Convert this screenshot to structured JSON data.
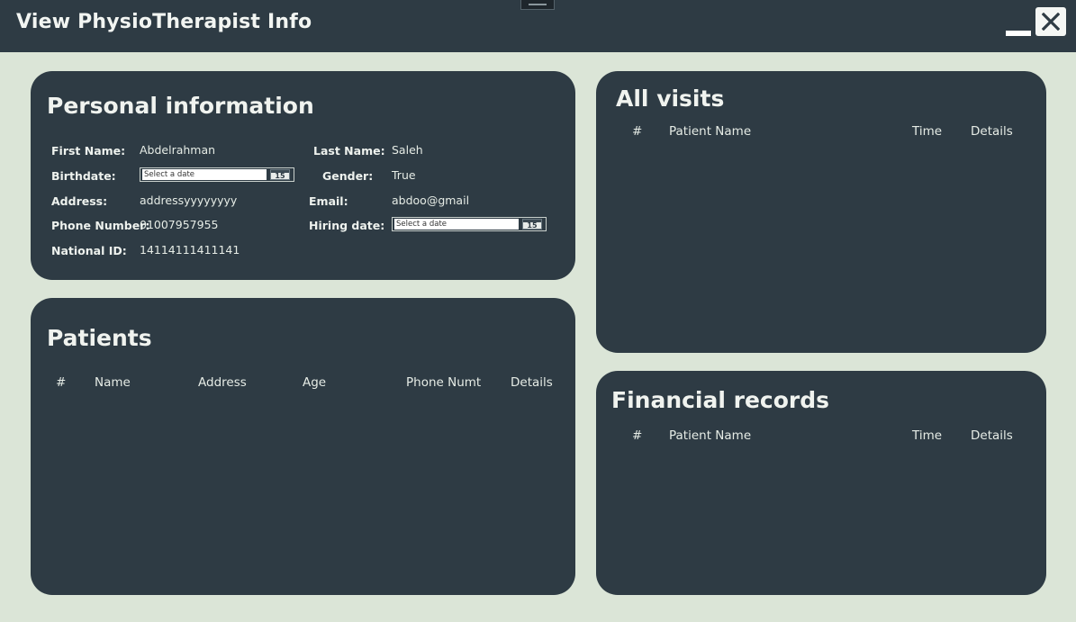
{
  "window": {
    "title": "View PhysioTherapist Info"
  },
  "personal": {
    "title": "Personal information",
    "first_name_label": "First Name:",
    "first_name": "Abdelrahman",
    "last_name_label": "Last Name:",
    "last_name": "Saleh",
    "birthdate_label": "Birthdate:",
    "birthdate_placeholder": "Select a date",
    "gender_label": "Gender:",
    "gender": "True",
    "address_label": "Address:",
    "address": "addressyyyyyyyy",
    "email_label": "Email:",
    "email": "abdoo@gmail",
    "phone_label": "Phone Number:",
    "phone": "01007957955",
    "hiring_label": "Hiring date:",
    "hiring_placeholder": "Select a date",
    "national_id_label": "National ID:",
    "national_id": "14114111411141",
    "calendar_day": "15"
  },
  "patients": {
    "title": "Patients",
    "columns": [
      "#",
      "Name",
      "Address",
      "Age",
      "Phone Numt",
      "Details"
    ],
    "rows": []
  },
  "visits": {
    "title": "All visits",
    "columns": [
      "#",
      "Patient Name",
      "Time",
      "Details"
    ],
    "rows": []
  },
  "financial": {
    "title": "Financial records",
    "columns": [
      "#",
      "Patient Name",
      "Time",
      "Details"
    ],
    "rows": []
  },
  "colors": {
    "background": "#dbe5d7",
    "panel": "#2e3b44",
    "text": "#e6ece6"
  }
}
